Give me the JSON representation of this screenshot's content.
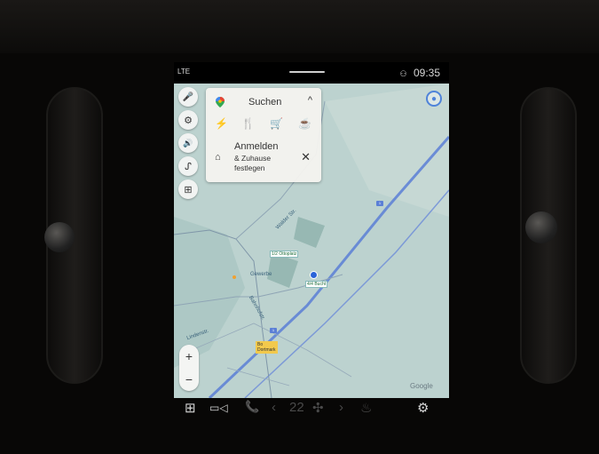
{
  "status": {
    "left_text": "LTE",
    "time": "09:35",
    "icon_left": "signal-location-icon",
    "icon_right": "user-icon"
  },
  "sidebar": {
    "items": [
      {
        "icon": "microphone-icon",
        "glyph": "🎤"
      },
      {
        "icon": "settings-icon",
        "glyph": "⚙"
      },
      {
        "icon": "volume-icon",
        "glyph": "🔊"
      },
      {
        "icon": "route-icon",
        "glyph": "ᔑ"
      },
      {
        "icon": "map-layers-icon",
        "glyph": "⊞"
      }
    ]
  },
  "panel": {
    "search_label": "Suchen",
    "collapse_glyph": "^",
    "categories": [
      {
        "icon": "charging-icon",
        "glyph": "⚡"
      },
      {
        "icon": "restaurant-icon",
        "glyph": "🍴"
      },
      {
        "icon": "shopping-icon",
        "glyph": "🛒"
      },
      {
        "icon": "coffee-icon",
        "glyph": "☕"
      }
    ],
    "signin_title": "Anmelden",
    "signin_sub_1": "& Zuhause",
    "signin_sub_2": "festlegen",
    "close_glyph": "✕"
  },
  "map": {
    "city_label_1": "Bo",
    "city_label_2": "Dortmark",
    "badge_1": "1/2 Ottoplatz",
    "badge_2": "4/4 Bucht",
    "label_1": "Walder Str.",
    "label_2": "Bahnhofstr.",
    "label_3": "Gewerbe",
    "label_4": "Lindenstr.",
    "watermark": "Google",
    "zoom_in": "+",
    "zoom_out": "−",
    "shield_1": "1",
    "shield_2": "1",
    "account_glyph": "👤"
  },
  "bottombar": {
    "items": [
      {
        "icon": "apps-grid-icon",
        "glyph": "⊞"
      },
      {
        "icon": "camera-icon",
        "glyph": "▭◁"
      },
      {
        "icon": "phone-icon",
        "glyph": "📞"
      },
      {
        "icon": "chevron-left-icon",
        "glyph": "‹"
      },
      {
        "icon": "temperature-icon",
        "glyph": "22"
      },
      {
        "icon": "fan-icon",
        "glyph": "✣"
      },
      {
        "icon": "chevron-right-icon",
        "glyph": "›"
      },
      {
        "icon": "seat-icon",
        "glyph": "♨"
      },
      {
        "icon": "settings-gear-icon",
        "glyph": "⚙"
      }
    ]
  },
  "colors": {
    "map_bg": "#bcd2cf",
    "highway": "#5b7fd6",
    "accent": "#4f83d9"
  }
}
